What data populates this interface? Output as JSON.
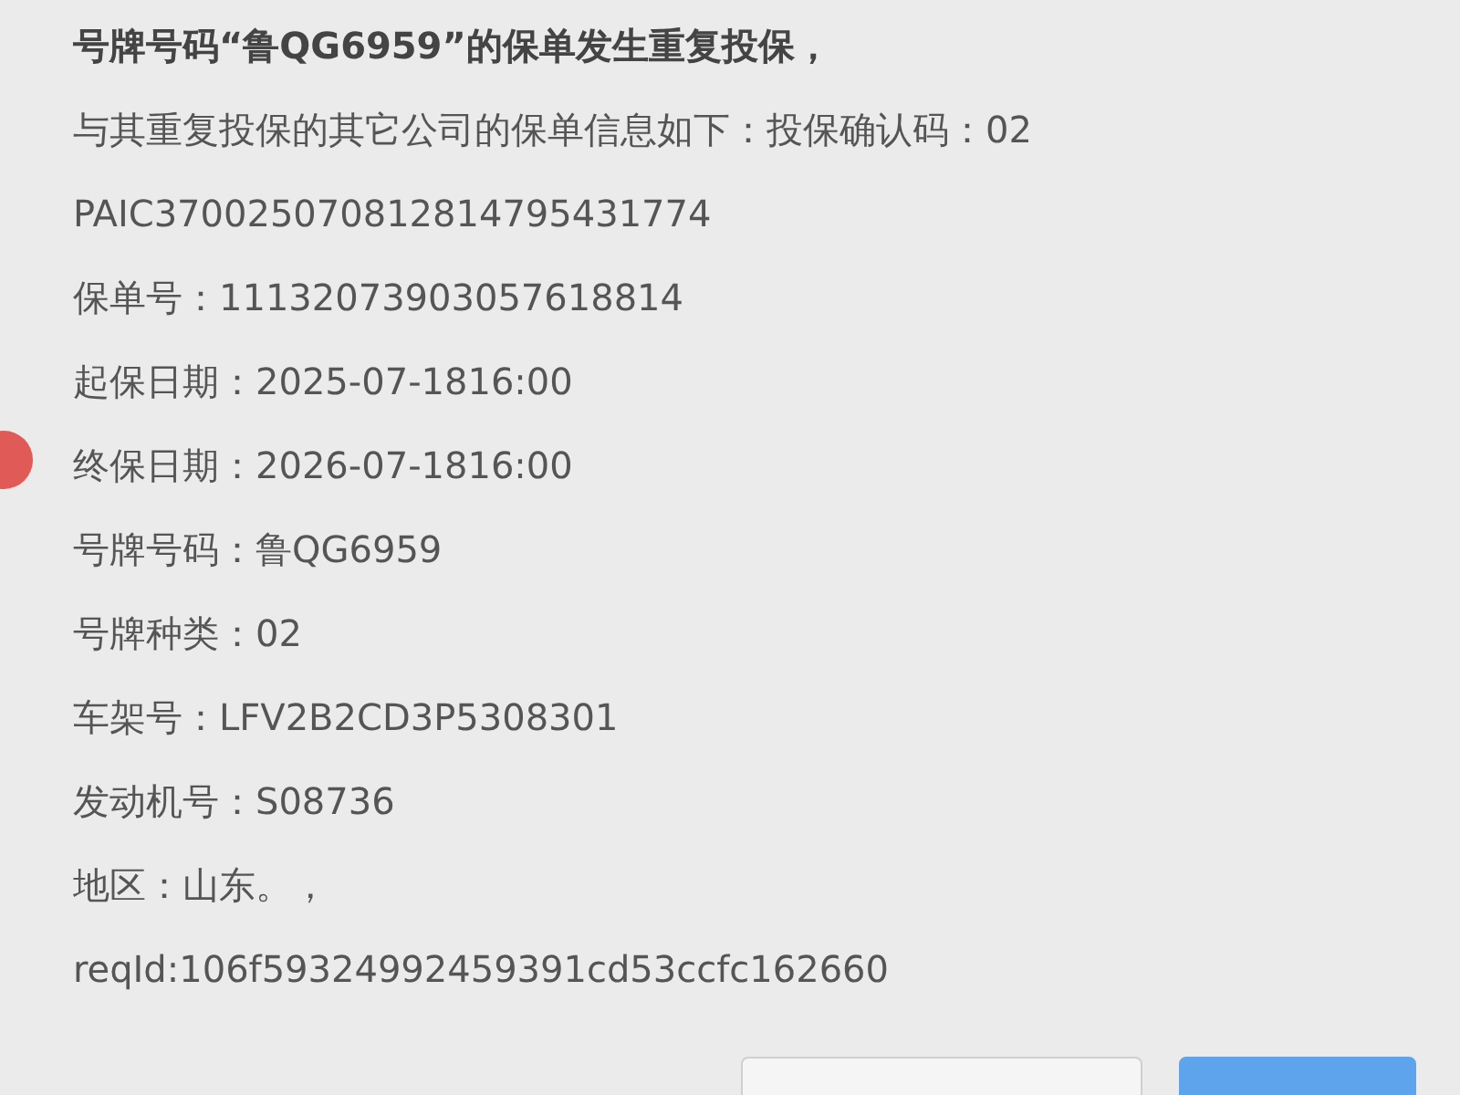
{
  "dialog": {
    "title": "号牌号码“鲁QG6959”的保单发生重复投保，",
    "lines": [
      "与其重复投保的其它公司的保单信息如下：投保确认码：02",
      "PAIC370025070812814795431774",
      "保单号：11132073903057618814",
      "起保日期：2025-07-1816:00",
      "终保日期：2026-07-1816:00",
      "号牌号码：鲁QG6959",
      "号牌种类：02",
      "车架号：LFV2B2CD3P5308301",
      "发动机号：S08736",
      "地区：山东。，",
      "reqId:106f59324992459391cd53ccfc162660"
    ],
    "buttons": [
      {
        "kind": "default"
      },
      {
        "kind": "primary"
      }
    ]
  }
}
